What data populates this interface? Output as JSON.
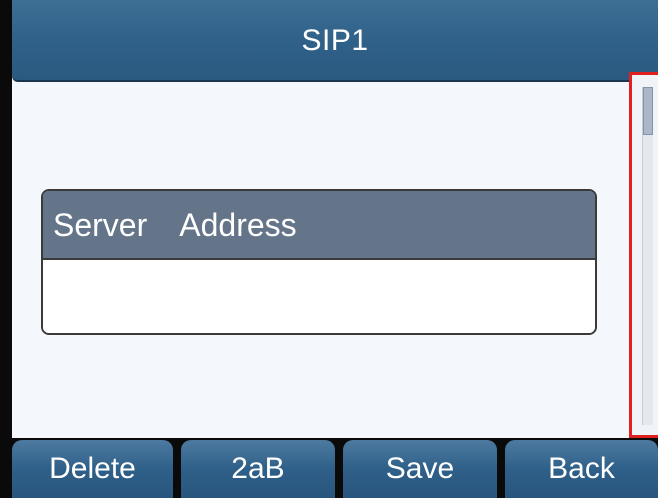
{
  "window": {
    "title": "SIP1"
  },
  "field": {
    "label": "Server  Address",
    "value": "",
    "placeholder": ""
  },
  "scrollbar": {
    "position_fraction": 0.0,
    "highlight_color": "#e02020"
  },
  "softkeys": [
    {
      "label": "Delete"
    },
    {
      "label": "2aB"
    },
    {
      "label": "Save"
    },
    {
      "label": "Back"
    }
  ],
  "colors": {
    "title_bar": "#2f6088",
    "field_label_bg": "#647489",
    "softkey_bg": "#2f6089",
    "highlight": "#e02020"
  }
}
